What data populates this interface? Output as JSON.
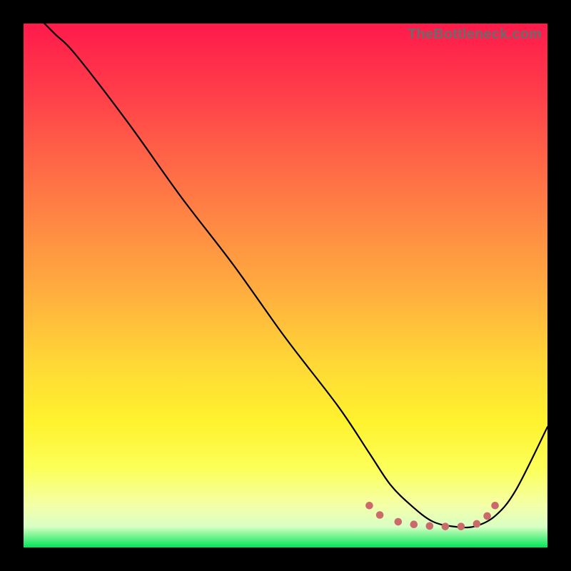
{
  "watermark": "TheBottleneck.com",
  "chart_data": {
    "type": "line",
    "title": "",
    "xlabel": "",
    "ylabel": "",
    "xlim": [
      0,
      100
    ],
    "ylim": [
      0,
      100
    ],
    "grid": false,
    "gradient_direction": "top-to-bottom",
    "gradient_stops": [
      {
        "pos": 0,
        "color": "#ff1a4b"
      },
      {
        "pos": 12,
        "color": "#ff3a4a"
      },
      {
        "pos": 25,
        "color": "#ff6247"
      },
      {
        "pos": 38,
        "color": "#ff8844"
      },
      {
        "pos": 52,
        "color": "#ffb03e"
      },
      {
        "pos": 65,
        "color": "#ffd836"
      },
      {
        "pos": 76,
        "color": "#fff22e"
      },
      {
        "pos": 85,
        "color": "#fcff59"
      },
      {
        "pos": 92,
        "color": "#f4ffa8"
      },
      {
        "pos": 96,
        "color": "#d9ffc4"
      },
      {
        "pos": 100,
        "color": "#00e756"
      }
    ],
    "series": [
      {
        "name": "bottleneck-curve",
        "color": "#000000",
        "x": [
          4,
          6,
          10,
          20,
          30,
          40,
          50,
          60,
          66,
          70,
          74,
          78,
          82,
          86,
          90,
          94,
          100
        ],
        "y": [
          100,
          98,
          94,
          81,
          67,
          54,
          40,
          27,
          18,
          12,
          8,
          5,
          4,
          4,
          6,
          11,
          23
        ]
      }
    ],
    "markers": {
      "name": "valley-markers",
      "color": "#cb6a6b",
      "radius_px": 5.3,
      "x": [
        66.0,
        68.0,
        71.5,
        74.5,
        77.5,
        80.5,
        83.5,
        86.5,
        88.5,
        90.0
      ],
      "y": [
        8.0,
        6.2,
        4.9,
        4.4,
        4.1,
        4.0,
        4.0,
        4.5,
        6.0,
        8.0
      ]
    }
  }
}
